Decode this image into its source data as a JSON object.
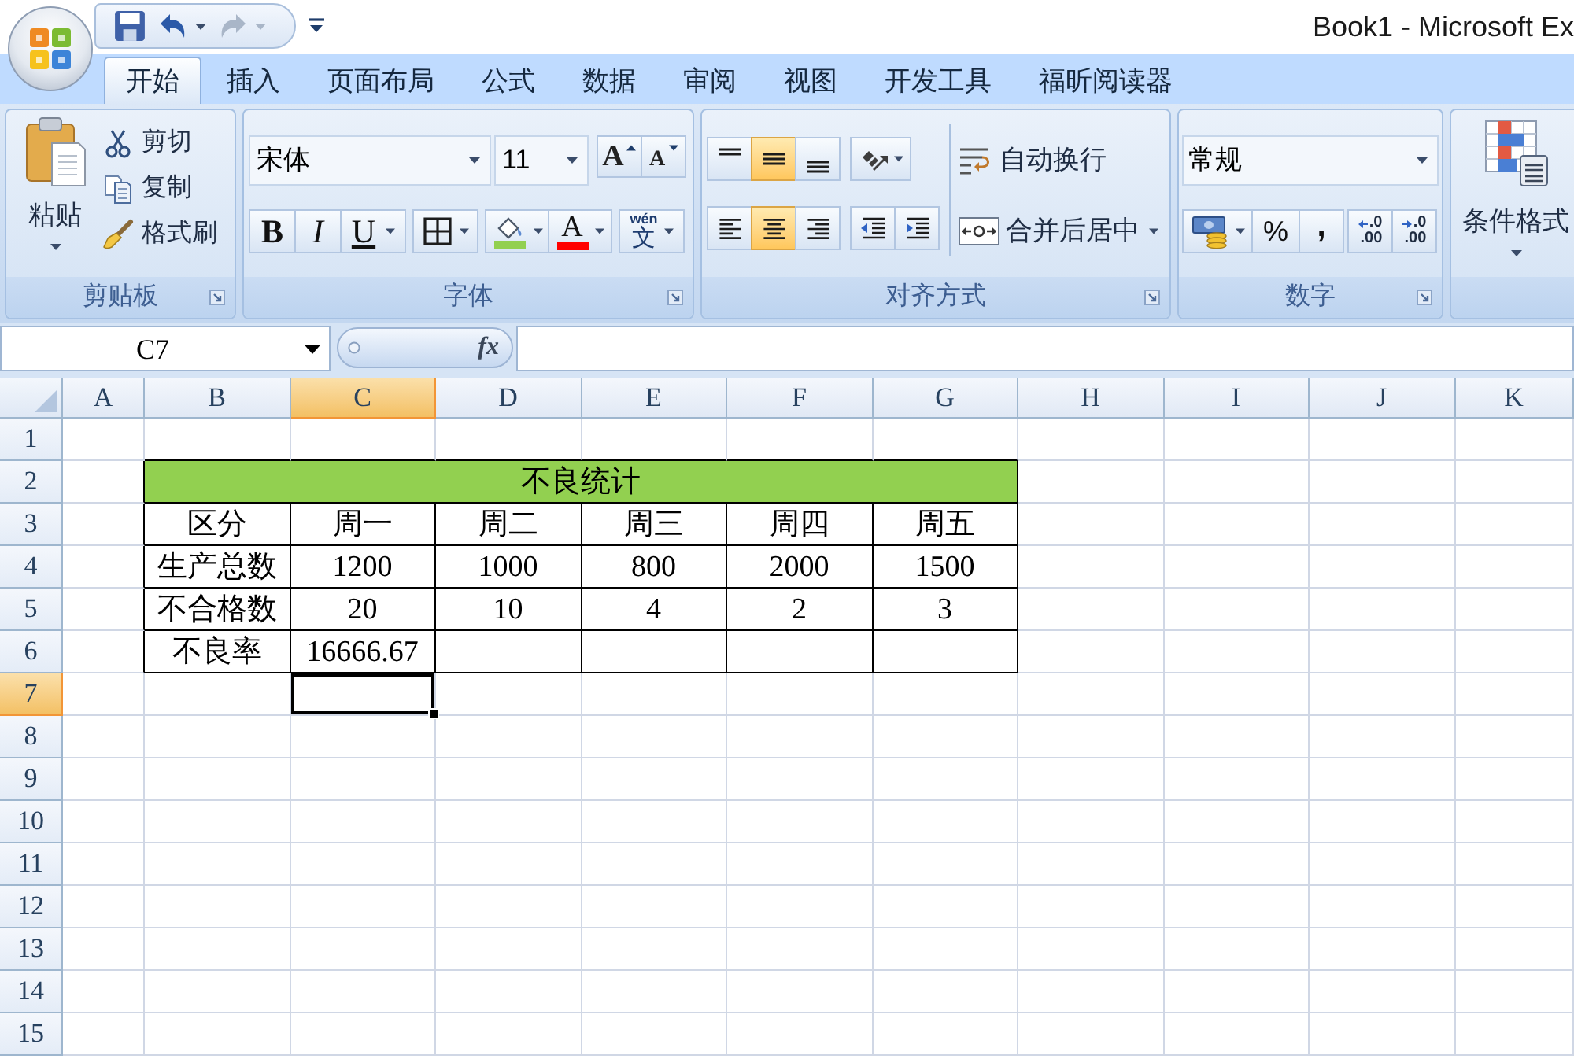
{
  "window": {
    "title": "Book1 - Microsoft Ex"
  },
  "quick_access": [
    {
      "kind": "save",
      "disabled": false
    },
    {
      "kind": "undo",
      "disabled": false
    },
    {
      "kind": "redo",
      "disabled": true
    }
  ],
  "tabs": [
    {
      "label": "开始",
      "selected": true
    },
    {
      "label": "插入",
      "selected": false
    },
    {
      "label": "页面布局",
      "selected": false
    },
    {
      "label": "公式",
      "selected": false
    },
    {
      "label": "数据",
      "selected": false
    },
    {
      "label": "审阅",
      "selected": false
    },
    {
      "label": "视图",
      "selected": false
    },
    {
      "label": "开发工具",
      "selected": false
    },
    {
      "label": "福昕阅读器",
      "selected": false
    }
  ],
  "ribbon": {
    "clipboard": {
      "label": "剪贴板",
      "paste": "粘贴",
      "items": [
        {
          "kind": "cut",
          "label": "剪切"
        },
        {
          "kind": "copy",
          "label": "复制"
        },
        {
          "kind": "format-painter",
          "label": "格式刷"
        }
      ]
    },
    "font": {
      "label": "字体",
      "font_name": "宋体",
      "font_size": "11",
      "grow_font": "A",
      "shrink_font": "A",
      "bold": "B",
      "italic": "I",
      "underline": "U",
      "font_color": "A",
      "phonetic": {
        "pinyin": "wén",
        "character": "文"
      }
    },
    "alignment": {
      "label": "对齐方式",
      "vertical": [
        {
          "kind": "top",
          "selected": false
        },
        {
          "kind": "middle",
          "selected": true
        },
        {
          "kind": "bottom",
          "selected": false
        }
      ],
      "horizontal": [
        {
          "kind": "left",
          "selected": false
        },
        {
          "kind": "center",
          "selected": true
        },
        {
          "kind": "right",
          "selected": false
        }
      ],
      "wrap_text": "自动换行",
      "merge_center": "合并后居中"
    },
    "number": {
      "label": "数字",
      "format": "常规",
      "percent": "%",
      "comma": ",",
      "increase_decimal": {
        "top": ".0",
        "bottom": ".00"
      },
      "decrease_decimal": {
        "top": ".0",
        "bottom": ".00"
      }
    },
    "styles": {
      "conditional_format": "条件格式"
    }
  },
  "formula_bar": {
    "name_box": "C7",
    "fx": "fx"
  },
  "sheet": {
    "columns": [
      {
        "label": "A",
        "selected": false
      },
      {
        "label": "B",
        "selected": false
      },
      {
        "label": "C",
        "selected": true
      },
      {
        "label": "D",
        "selected": false
      },
      {
        "label": "E",
        "selected": false
      },
      {
        "label": "F",
        "selected": false
      },
      {
        "label": "G",
        "selected": false
      },
      {
        "label": "H",
        "selected": false
      },
      {
        "label": "I",
        "selected": false
      },
      {
        "label": "J",
        "selected": false
      },
      {
        "label": "K",
        "selected": false
      }
    ],
    "rows": [
      {
        "label": "1",
        "selected": false
      },
      {
        "label": "2",
        "selected": false
      },
      {
        "label": "3",
        "selected": false
      },
      {
        "label": "4",
        "selected": false
      },
      {
        "label": "5",
        "selected": false
      },
      {
        "label": "6",
        "selected": false
      },
      {
        "label": "7",
        "selected": true
      },
      {
        "label": "8",
        "selected": false
      },
      {
        "label": "9",
        "selected": false
      },
      {
        "label": "10",
        "selected": false
      },
      {
        "label": "11",
        "selected": false
      },
      {
        "label": "12",
        "selected": false
      },
      {
        "label": "13",
        "selected": false
      },
      {
        "label": "14",
        "selected": false
      },
      {
        "label": "15",
        "selected": false
      }
    ],
    "table": {
      "title": "不良统计",
      "header": [
        "区分",
        "周一",
        "周二",
        "周三",
        "周四",
        "周五"
      ],
      "rows": [
        {
          "label": "生产总数",
          "values": [
            "1200",
            "1000",
            "800",
            "2000",
            "1500"
          ]
        },
        {
          "label": "不合格数",
          "values": [
            "20",
            "10",
            "4",
            "2",
            "3"
          ]
        },
        {
          "label": "不良率",
          "values": [
            "16666.67"
          ]
        }
      ]
    }
  }
}
